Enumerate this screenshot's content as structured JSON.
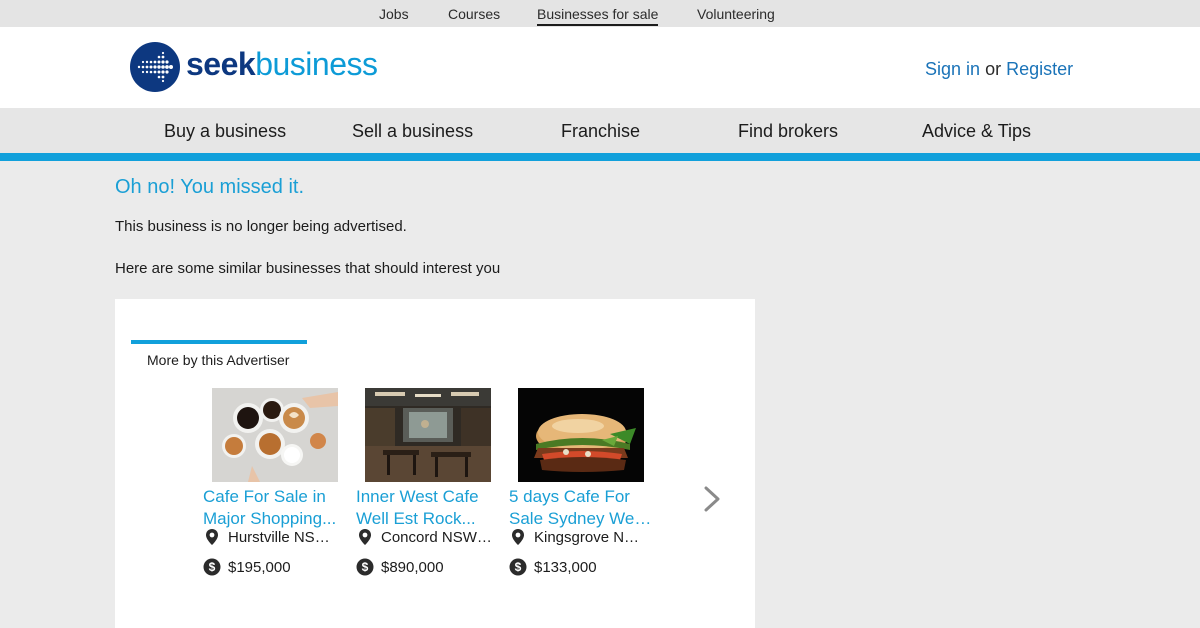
{
  "topbar": {
    "links": [
      {
        "label": "Jobs"
      },
      {
        "label": "Courses"
      },
      {
        "label": "Businesses for sale"
      },
      {
        "label": "Volunteering"
      }
    ]
  },
  "header": {
    "logo": {
      "part1": "seek",
      "part2": "business",
      "icon": "seek-dotted-arrow-icon"
    },
    "sign_in": "Sign in",
    "or": "or",
    "register": "Register"
  },
  "nav": {
    "items": [
      {
        "label": "Buy a business"
      },
      {
        "label": "Sell a business"
      },
      {
        "label": "Franchise"
      },
      {
        "label": "Find brokers"
      },
      {
        "label": "Advice & Tips"
      }
    ]
  },
  "main": {
    "headline": "Oh no! You missed it.",
    "message": "This business is no longer being advertised.",
    "similar_intro": "Here are some similar businesses that should interest you"
  },
  "panel": {
    "tab_label": "More by this Advertiser",
    "listings": [
      {
        "title_line1": "Cafe For Sale in",
        "title_line2": "Major Shopping...",
        "location": "Hurstville NSW...",
        "price": "$195,000",
        "image": "coffee-cups-photo"
      },
      {
        "title_line1": "Inner West Cafe",
        "title_line2": "Well Est Rock...",
        "location": "Concord NSW ...",
        "price": "$890,000",
        "image": "cafe-interior-photo"
      },
      {
        "title_line1": "5 days Cafe For",
        "title_line2": "Sale Sydney Wes...",
        "location": "Kingsgrove NS...",
        "price": "$133,000",
        "image": "burger-photo"
      }
    ],
    "next_icon": "chevron-right-icon"
  },
  "colors": {
    "accent": "#11a0db",
    "link": "#1a73b8",
    "brand_dark": "#0d3880"
  }
}
